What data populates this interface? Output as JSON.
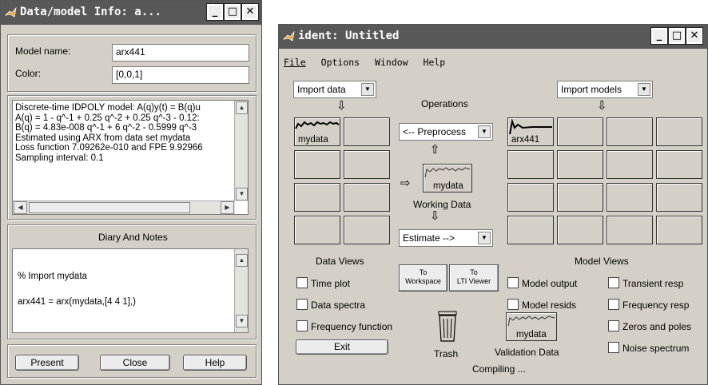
{
  "info_window": {
    "title": "Data/model Info: a...",
    "model_name_label": "Model name:",
    "model_name_value": "arx441",
    "color_label": "Color:",
    "color_value": "[0,0,1]",
    "info_lines": [
      "Discrete-time IDPOLY model: A(q)y(t) = B(q)u",
      "A(q) = 1 - q^-1 + 0.25 q^-2 + 0.25 q^-3 - 0.12:",
      "B(q) = 4.83e-008 q^-1 + 6 q^-2 - 0.5999 q^-3",
      "Estimated using ARX from data set mydata",
      "Loss function 7.09262e-010 and FPE 9.92966",
      "Sampling interval: 0.1"
    ],
    "diary_title": "Diary And Notes",
    "diary_lines": [
      "% Import   mydata",
      "",
      "arx441 = arx(mydata,[4 4 1],)"
    ],
    "buttons": {
      "present": "Present",
      "close": "Close",
      "help": "Help"
    }
  },
  "ident_window": {
    "title": "ident: Untitled",
    "menu": {
      "file": "File",
      "options": "Options",
      "window": "Window",
      "help": "Help"
    },
    "import_data": "Import data",
    "import_models": "Import models",
    "operations": "Operations",
    "preprocess": "<-- Preprocess",
    "working_data": "Working Data",
    "working_data_name": "mydata",
    "estimate": "Estimate -->",
    "data_slot_name": "mydata",
    "model_slot_name": "arx441",
    "data_views": "Data Views",
    "model_views": "Model Views",
    "to_workspace": [
      "To",
      "Workspace"
    ],
    "to_lti": [
      "To",
      "LTI Viewer"
    ],
    "data_checks": [
      "Time plot",
      "Data spectra",
      "Frequency function"
    ],
    "model_checks_left": [
      "Model output",
      "Model resids"
    ],
    "model_checks_right": [
      "Transient resp",
      "Frequency resp",
      "Zeros and poles",
      "Noise spectrum"
    ],
    "exit": "Exit",
    "trash": "Trash",
    "validation_data": "Validation Data",
    "validation_name": "mydata",
    "status": "Compiling ..."
  },
  "colors": {
    "titlebar": "#585858",
    "window_bg": "#d4d0c8"
  }
}
